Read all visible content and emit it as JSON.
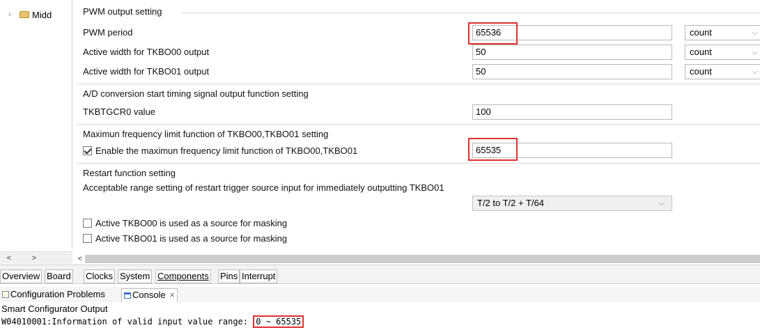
{
  "tree": {
    "item_label": "Midd",
    "expand_glyph": "›"
  },
  "tree_scroll": {
    "left": "<",
    "right": ">"
  },
  "main_scroll": {
    "left": "<"
  },
  "groups": {
    "pwm": {
      "title": "PWM output setting",
      "rows": [
        {
          "label": "PWM period",
          "value": "65536",
          "unit": "count"
        },
        {
          "label": "Active width for TKBO00 output",
          "value": "50",
          "unit": "count"
        },
        {
          "label": "Active width for TKBO01 output",
          "value": "50",
          "unit": "count"
        }
      ]
    },
    "adc": {
      "title": "A/D conversion start timing signal output function setting",
      "row": {
        "label": "TKBTGCR0 value",
        "value": "100"
      }
    },
    "maxfreq": {
      "title": "Maximun frequency limit function of TKBO00,TKBO01 setting",
      "checkbox_label": "Enable the maximun frequency limit function of TKBO00,TKBO01",
      "checked": true,
      "value": "65535"
    },
    "restart": {
      "title": "Restart function setting",
      "desc": "Acceptable range setting of restart trigger source input for immediately outputting TKBO01",
      "select_value": "T/2 to T/2 + T/64",
      "mask0_label": "Active TKBO00 is used as a source for masking",
      "mask1_label": "Active TKBO01 is used as a source for masking"
    }
  },
  "tabs": [
    "Overview",
    "Board",
    "Clocks",
    "System",
    "Components",
    "Pins",
    "Interrupt"
  ],
  "active_tab": "Components",
  "console_tabs": {
    "problems": "Configuration Problems",
    "console": "Console",
    "close": "×"
  },
  "console": {
    "title": "Smart Configurator Output",
    "message_prefix": "W04010001:Information of valid input value range:",
    "message_range": "0 ~ 65535"
  },
  "colors": {
    "highlight": "#e03030",
    "accent": "#3b73c8"
  }
}
